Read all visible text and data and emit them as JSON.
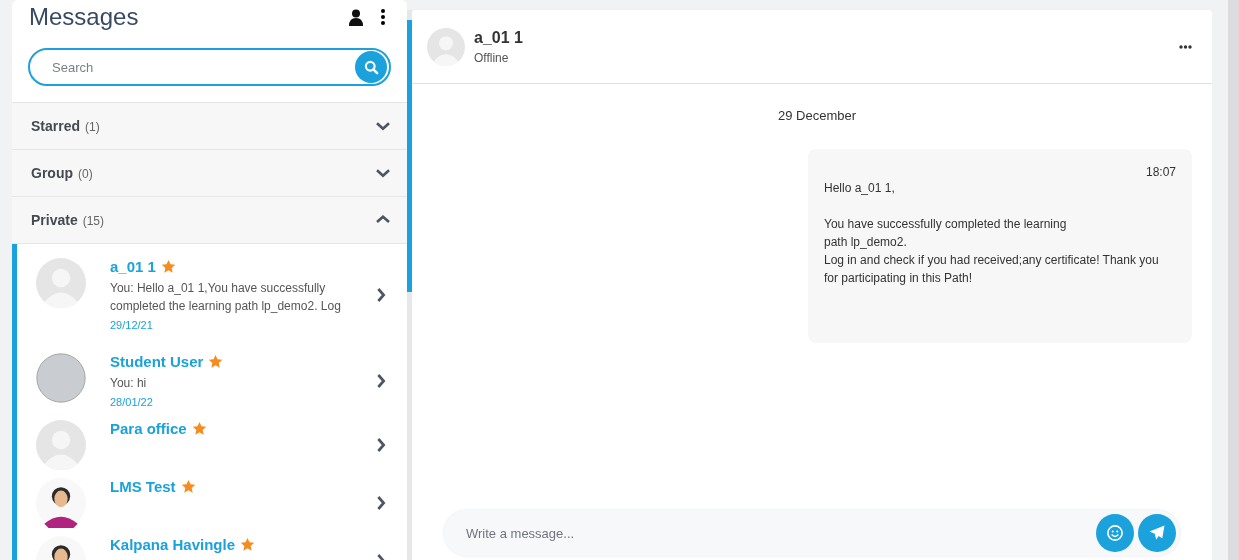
{
  "sidebar": {
    "title": "Messages",
    "search": {
      "placeholder": "Search"
    },
    "sections": [
      {
        "label": "Starred",
        "count": "(1)",
        "expanded": false
      },
      {
        "label": "Group",
        "count": "(0)",
        "expanded": false
      },
      {
        "label": "Private",
        "count": "(15)",
        "expanded": true,
        "contacts": [
          {
            "name": "a_01 1",
            "starred": true,
            "preview": "You: Hello a_01 1,You have successfully completed the learning path lp_demo2. Log",
            "date": "29/12/21",
            "kind": "placeholder"
          },
          {
            "name": "Student User",
            "starred": true,
            "preview": "You: hi",
            "date": "28/01/22",
            "kind": "photo"
          },
          {
            "name": "Para office",
            "starred": true,
            "kind": "placeholder"
          },
          {
            "name": "LMS Test",
            "starred": true,
            "kind": "illustration"
          },
          {
            "name": "Kalpana Havingle",
            "starred": true,
            "kind": "illustration"
          }
        ]
      }
    ]
  },
  "chat": {
    "contact": {
      "name": "a_01 1",
      "status": "Offline"
    },
    "date_divider": "29 December",
    "messages": [
      {
        "time": "18:07",
        "body": "Hello a_01 1,\n\nYou have successfully completed the learning\npath lp_demo2.\nLog in and check if you had received;any certificate! Thank you for participating in this Path!"
      }
    ],
    "composer": {
      "placeholder": "Write a message..."
    }
  }
}
